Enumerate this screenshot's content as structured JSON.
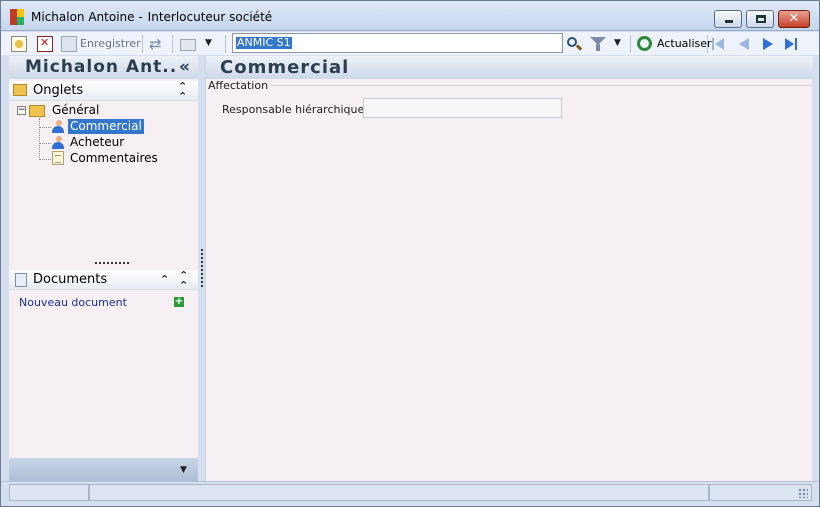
{
  "window": {
    "title_name": "Michalon Antoine -",
    "title_context": "Interlocuteur société",
    "close_symbol": "✕"
  },
  "toolbar": {
    "save_label": "Enregistrer",
    "search_value": "ANMIC S1",
    "refresh_label": "Actualiser"
  },
  "left_panel": {
    "title": "Michalon Ant..",
    "collapse_symbol": "«",
    "tabs_section": {
      "label": "Onglets",
      "tree": {
        "expander_symbol": "−",
        "root": "Général",
        "children": [
          "Commercial",
          "Acheteur",
          "Commentaires"
        ],
        "selected": "Commercial"
      }
    },
    "documents_section": {
      "label": "Documents",
      "new_document_label": "Nouveau document"
    }
  },
  "main": {
    "title": "Commercial",
    "group_label": "Affectation",
    "fields": [
      {
        "label": "Responsable hiérarchique :",
        "value": ""
      }
    ]
  },
  "colors": {
    "selection": "#3377cc",
    "header_text": "#2c3e50",
    "link": "#1a2fa0",
    "panel_bg": "#f6eff4"
  }
}
